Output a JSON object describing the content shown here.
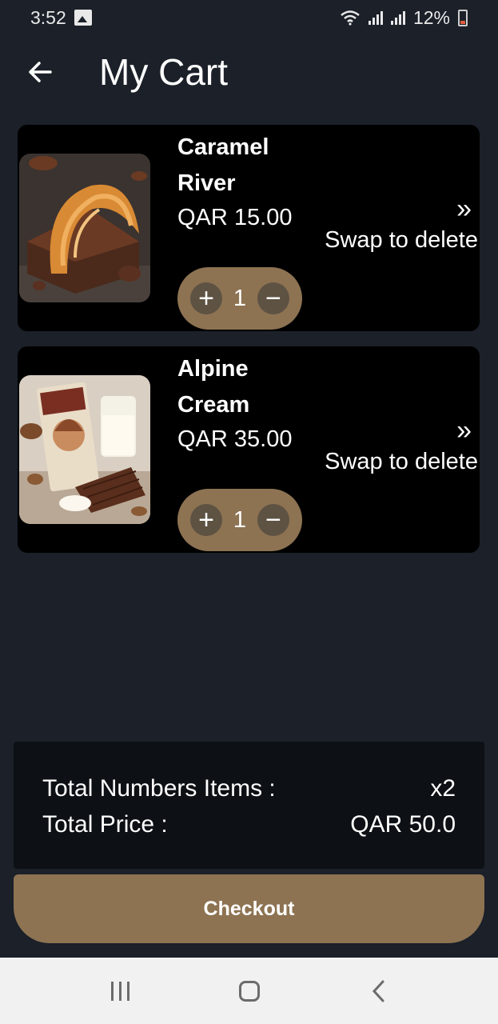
{
  "status_bar": {
    "time": "3:52",
    "battery": "12%",
    "icons": [
      "gallery-icon",
      "wifi-icon",
      "signal-icon",
      "battery-icon"
    ]
  },
  "header": {
    "back_icon": "arrow-left-icon",
    "title": "My Cart"
  },
  "cart": {
    "items": [
      {
        "name": "Caramel River",
        "price": "QAR 15.00",
        "quantity": "1",
        "plus": "+",
        "minus": "−",
        "swipe_icon": "»",
        "swipe_text": "Swap to delete",
        "image": "caramel-chocolate-image"
      },
      {
        "name": "Alpine Cream",
        "price": "QAR 35.00",
        "quantity": "1",
        "plus": "+",
        "minus": "−",
        "swipe_icon": "»",
        "swipe_text": "Swap to delete",
        "image": "alpine-cream-chocolate-image"
      }
    ]
  },
  "summary": {
    "items_label": "Total Numbers Items :",
    "items_value": "x2",
    "price_label": "Total Price :",
    "price_value": "QAR 50.0"
  },
  "checkout": {
    "label": "Checkout"
  },
  "colors": {
    "background": "#1b2029",
    "card": "#000000",
    "accent": "#8d7352",
    "summary": "#0d1014"
  },
  "nav_bar": {
    "icons": [
      "recents-icon",
      "home-icon",
      "back-icon"
    ]
  }
}
